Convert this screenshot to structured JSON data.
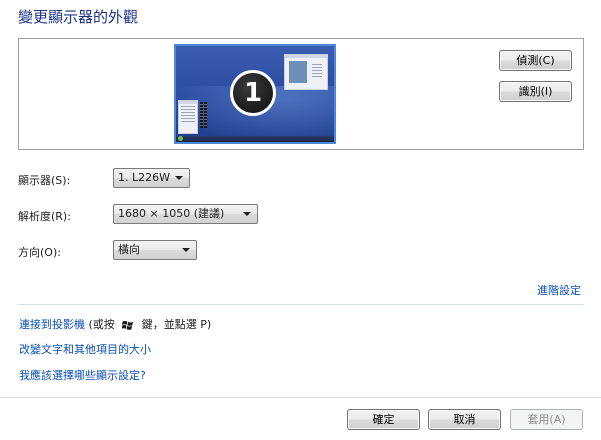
{
  "title": "變更顯示器的外觀",
  "preview": {
    "monitor_number": "1",
    "detect_button": "偵測(C)",
    "identify_button": "識別(I)"
  },
  "settings": {
    "display": {
      "label": "顯示器(S):",
      "value": "1. L226W"
    },
    "resolution": {
      "label": "解析度(R):",
      "value": "1680 × 1050 (建議)"
    },
    "orientation": {
      "label": "方向(O):",
      "value": "橫向"
    }
  },
  "advanced_link": "進階設定",
  "links": {
    "projector_link": "連接到投影機",
    "projector_hint_prefix": "(或按",
    "projector_hint_suffix": "鍵，並點選 P)",
    "text_size_link": "改變文字和其他項目的大小",
    "help_link": "我應該選擇哪些顯示設定?"
  },
  "footer": {
    "ok": "確定",
    "cancel": "取消",
    "apply": "套用(A)"
  },
  "icons": {
    "windows_key": "windows-logo-icon",
    "dropdown": "chevron-down-icon"
  },
  "colors": {
    "title": "#1e3287",
    "link": "#0b4fb0",
    "monitor_border": "#4b8ad8",
    "desktop": "#2a4a9e"
  }
}
